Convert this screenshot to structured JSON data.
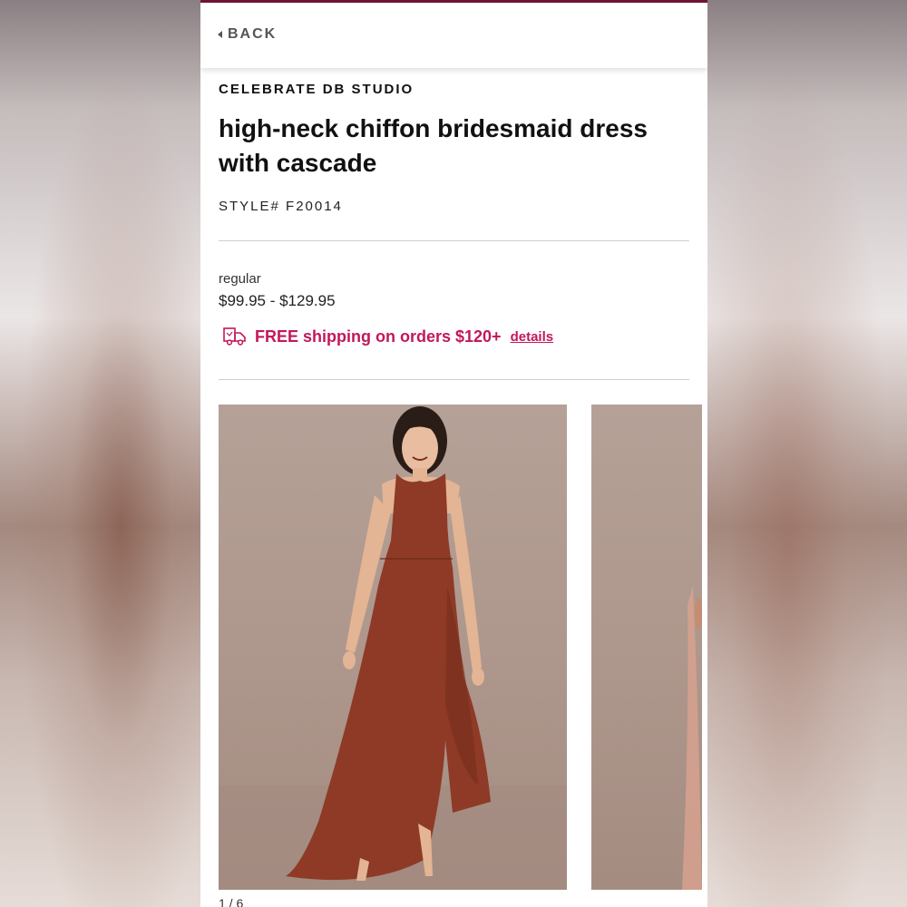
{
  "header": {
    "back_label": "BACK"
  },
  "product": {
    "brand": "CELEBRATE DB STUDIO",
    "title": "high-neck chiffon bridesmaid dress with cascade",
    "style_number": "STYLE# F20014",
    "price_label": "regular",
    "price_range": "$99.95 - $129.95"
  },
  "shipping": {
    "text": "FREE shipping on orders $120+",
    "link_label": "details",
    "icon": "truck-icon"
  },
  "gallery": {
    "images": [
      {
        "alt": "model wearing rust high-neck chiffon dress",
        "icon": "product-photo"
      },
      {
        "alt": "second product photo (partially visible)",
        "icon": "product-photo"
      }
    ],
    "pager": "1 / 6"
  },
  "colors": {
    "accent": "#c2185b",
    "top_bar": "#6f1436",
    "dress": "#8e3a26",
    "photo_bg": "#ae978c"
  }
}
